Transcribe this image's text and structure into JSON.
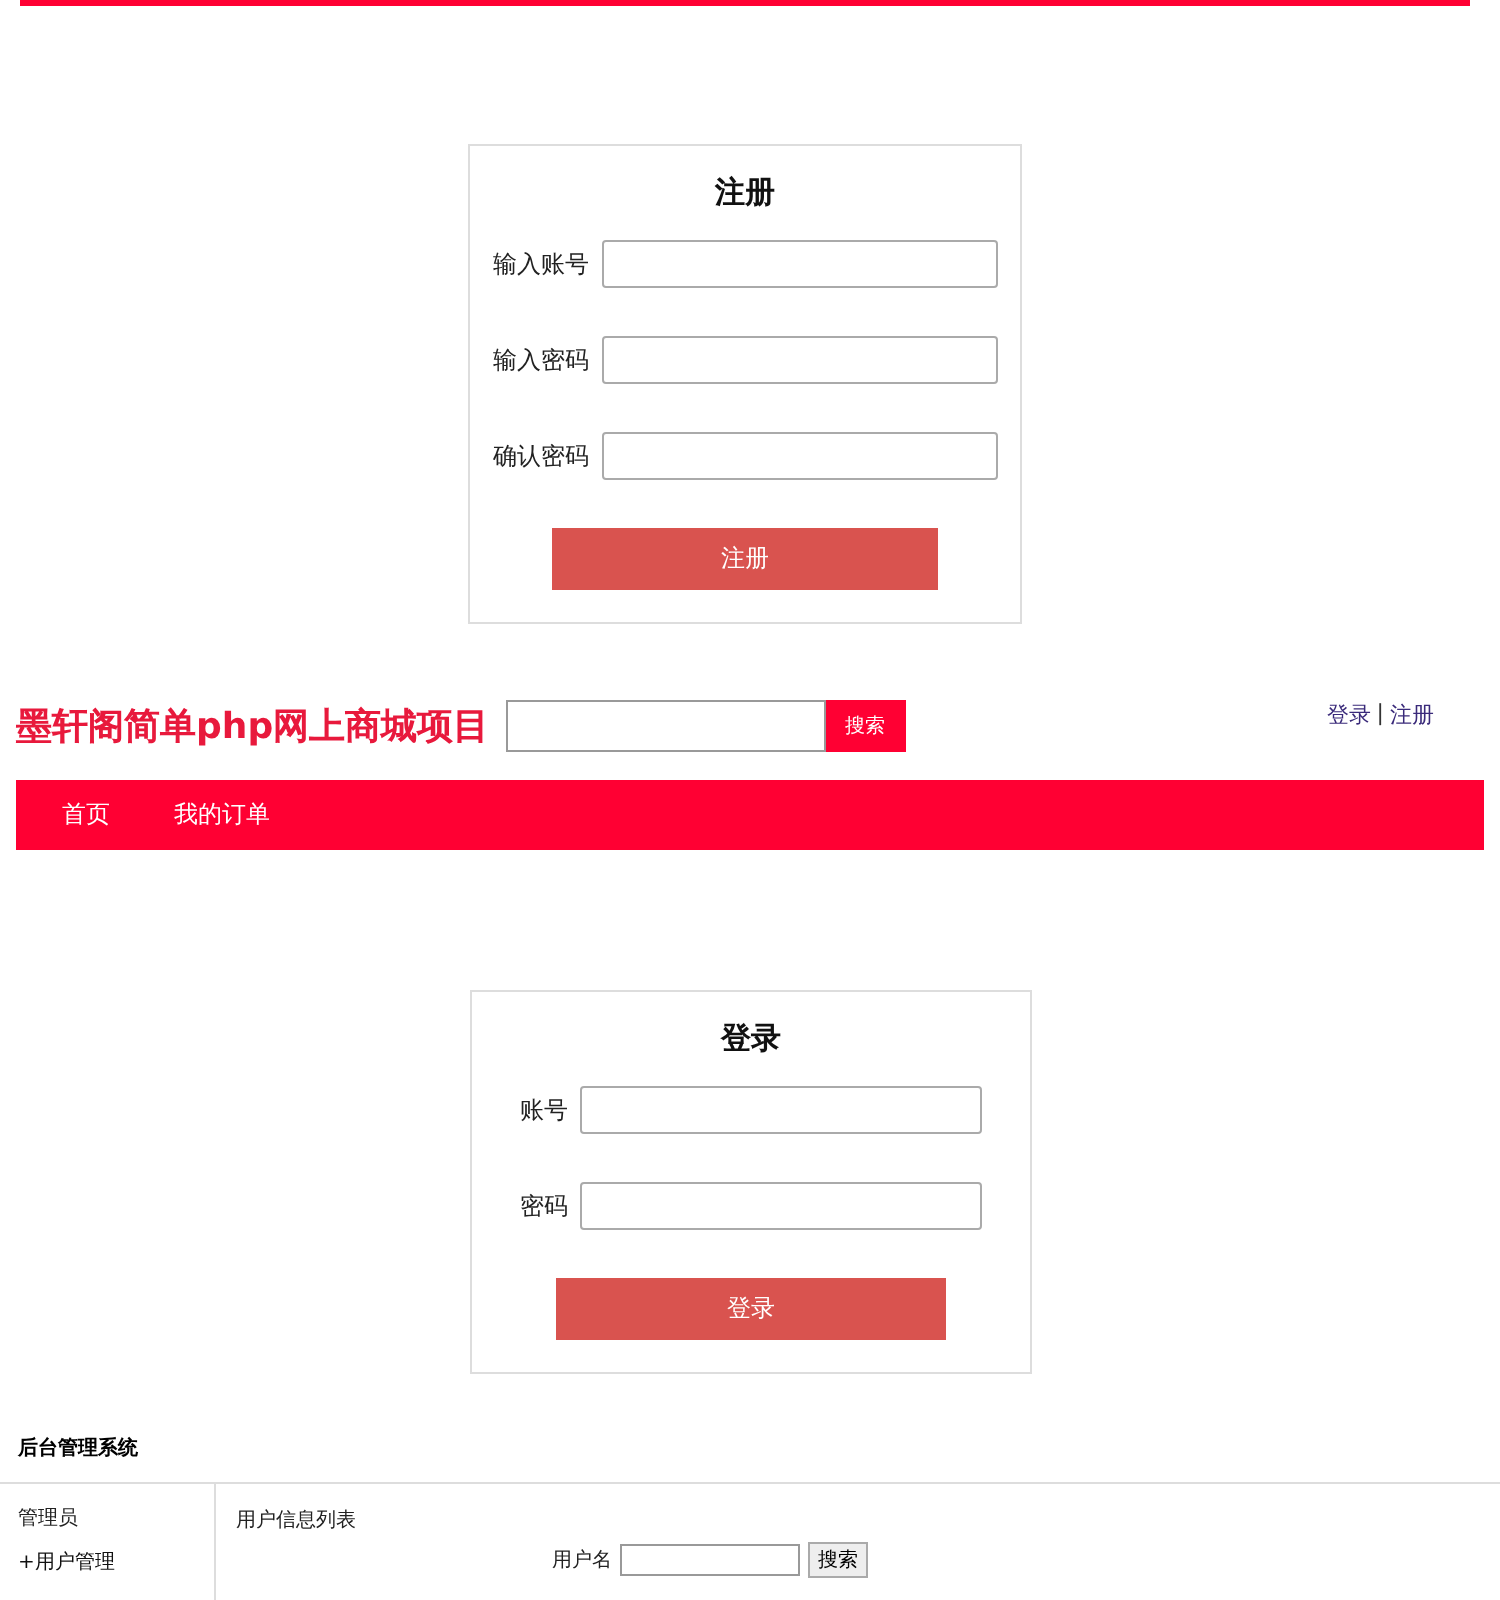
{
  "register": {
    "title": "注册",
    "fields": [
      {
        "label": "输入账号"
      },
      {
        "label": "输入密码"
      },
      {
        "label": "确认密码"
      }
    ],
    "button": "注册"
  },
  "header": {
    "logo": "墨轩阁简单php网上商城项目",
    "search_button": "搜索",
    "links": [
      "登录",
      "|",
      "注册"
    ]
  },
  "nav": {
    "items": [
      {
        "label": "首页"
      },
      {
        "label": "我的订单"
      }
    ]
  },
  "login": {
    "title": "登录",
    "fields": [
      {
        "label": "账号"
      },
      {
        "label": "密码"
      }
    ],
    "button": "登录"
  },
  "admin": {
    "title": "后台管理系统",
    "sidebar": {
      "heading": "管理员",
      "items": [
        "+用户管理"
      ]
    },
    "main": {
      "title": "用户信息列表",
      "search_label": "用户名",
      "search_button": "搜索"
    }
  }
}
